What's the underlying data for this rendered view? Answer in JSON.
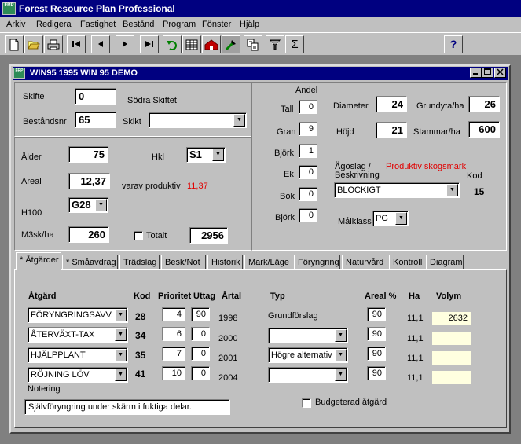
{
  "app": {
    "title": "Forest Resource Plan Professional",
    "icon_text": "FRP"
  },
  "menu": [
    "Arkiv",
    "Redigera",
    "Fastighet",
    "Bestånd",
    "Program",
    "Fönster",
    "Hjälp"
  ],
  "toolbar": {
    "buttons": [
      "new-icon",
      "open-icon",
      "print-icon",
      "first-icon",
      "prev-icon",
      "next-icon",
      "last-icon",
      "undo-icon",
      "table-icon",
      "house-icon",
      "tool-icon",
      "export-icon",
      "filter-icon",
      "sum-icon",
      "help-icon"
    ],
    "help_label": "?",
    "sum_label": "Σ"
  },
  "window": {
    "title": "WIN95 1995 WIN 95 DEMO"
  },
  "stand": {
    "skifte_label": "Skifte",
    "skifte_value": "0",
    "skifte_name": "Södra Skiftet",
    "bestandsnr_label": "Beståndsnr",
    "bestandsnr_value": "65",
    "skikt_label": "Skikt",
    "skikt_value": ""
  },
  "details": {
    "alder_label": "Ålder",
    "alder_value": "75",
    "hkl_label": "Hkl",
    "hkl_value": "S1",
    "areal_label": "Areal",
    "areal_value": "12,37",
    "varav_label": "varav produktiv",
    "varav_value": "11,37",
    "h100_label": "H100",
    "h100_value": "G28",
    "m3sk_label": "M3sk/ha",
    "m3sk_value": "260",
    "totalt_label": "Totalt",
    "totalt_value": "2956"
  },
  "species": {
    "andel_label": "Andel",
    "rows": [
      {
        "name": "Tall",
        "value": "0"
      },
      {
        "name": "Gran",
        "value": "9"
      },
      {
        "name": "Björk",
        "value": "1"
      },
      {
        "name": "Ek",
        "value": "0"
      },
      {
        "name": "Bok",
        "value": "0"
      },
      {
        "name": "Björk",
        "value": "0"
      }
    ]
  },
  "metrics": {
    "diameter_label": "Diameter",
    "diameter_value": "24",
    "grundyta_label": "Grundyta/ha",
    "grundyta_value": "26",
    "hojd_label": "Höjd",
    "hojd_value": "21",
    "stammar_label": "Stammar/ha",
    "stammar_value": "600",
    "agoslag_label_1": "Ägoslag /",
    "agoslag_label_2": "Beskrivning",
    "agoslag_status": "Produktiv skogsmark",
    "kod_label": "Kod",
    "beskrivning_value": "BLOCKIGT",
    "kod_value": "15",
    "malklass_label": "Målklass",
    "malklass_value": "PG"
  },
  "tabs": [
    "* Åtgärder",
    "* Småavdrag",
    "Trädslag",
    "Besk/Not",
    "Historik",
    "Mark/Läge",
    "Föryngring",
    "Naturvård",
    "Kontroll",
    "Diagram"
  ],
  "actions": {
    "headers": {
      "atgard": "Åtgärd",
      "kod": "Kod",
      "prioritet": "Prioritet",
      "uttag": "Uttag",
      "artal": "Årtal",
      "typ": "Typ",
      "areal": "Areal %",
      "ha": "Ha",
      "volym": "Volym"
    },
    "rows": [
      {
        "atgard": "FÖRYNGRINGSAVV.",
        "kod": "28",
        "prioritet": "4",
        "uttag": "90",
        "artal": "1998",
        "typ": "Grundförslag",
        "typ_combo": false,
        "areal": "90",
        "ha": "11,1",
        "volym": "2632"
      },
      {
        "atgard": "ÅTERVÄXT-TAX",
        "kod": "34",
        "prioritet": "6",
        "uttag": "0",
        "artal": "2000",
        "typ": "",
        "typ_combo": true,
        "areal": "90",
        "ha": "11,1",
        "volym": ""
      },
      {
        "atgard": "HJÄLPPLANT",
        "kod": "35",
        "prioritet": "7",
        "uttag": "0",
        "artal": "2001",
        "typ": "Högre alternativ",
        "typ_combo": true,
        "areal": "90",
        "ha": "11,1",
        "volym": ""
      },
      {
        "atgard": "RÖJNING LÖV",
        "kod": "41",
        "prioritet": "10",
        "uttag": "0",
        "artal": "2004",
        "typ": "",
        "typ_combo": true,
        "areal": "90",
        "ha": "11,1",
        "volym": ""
      }
    ],
    "notering_label": "Notering",
    "notering_value": "Självföryngring under skärm i fuktiga delar.",
    "budgeterad_label": "Budgeterad åtgärd"
  }
}
